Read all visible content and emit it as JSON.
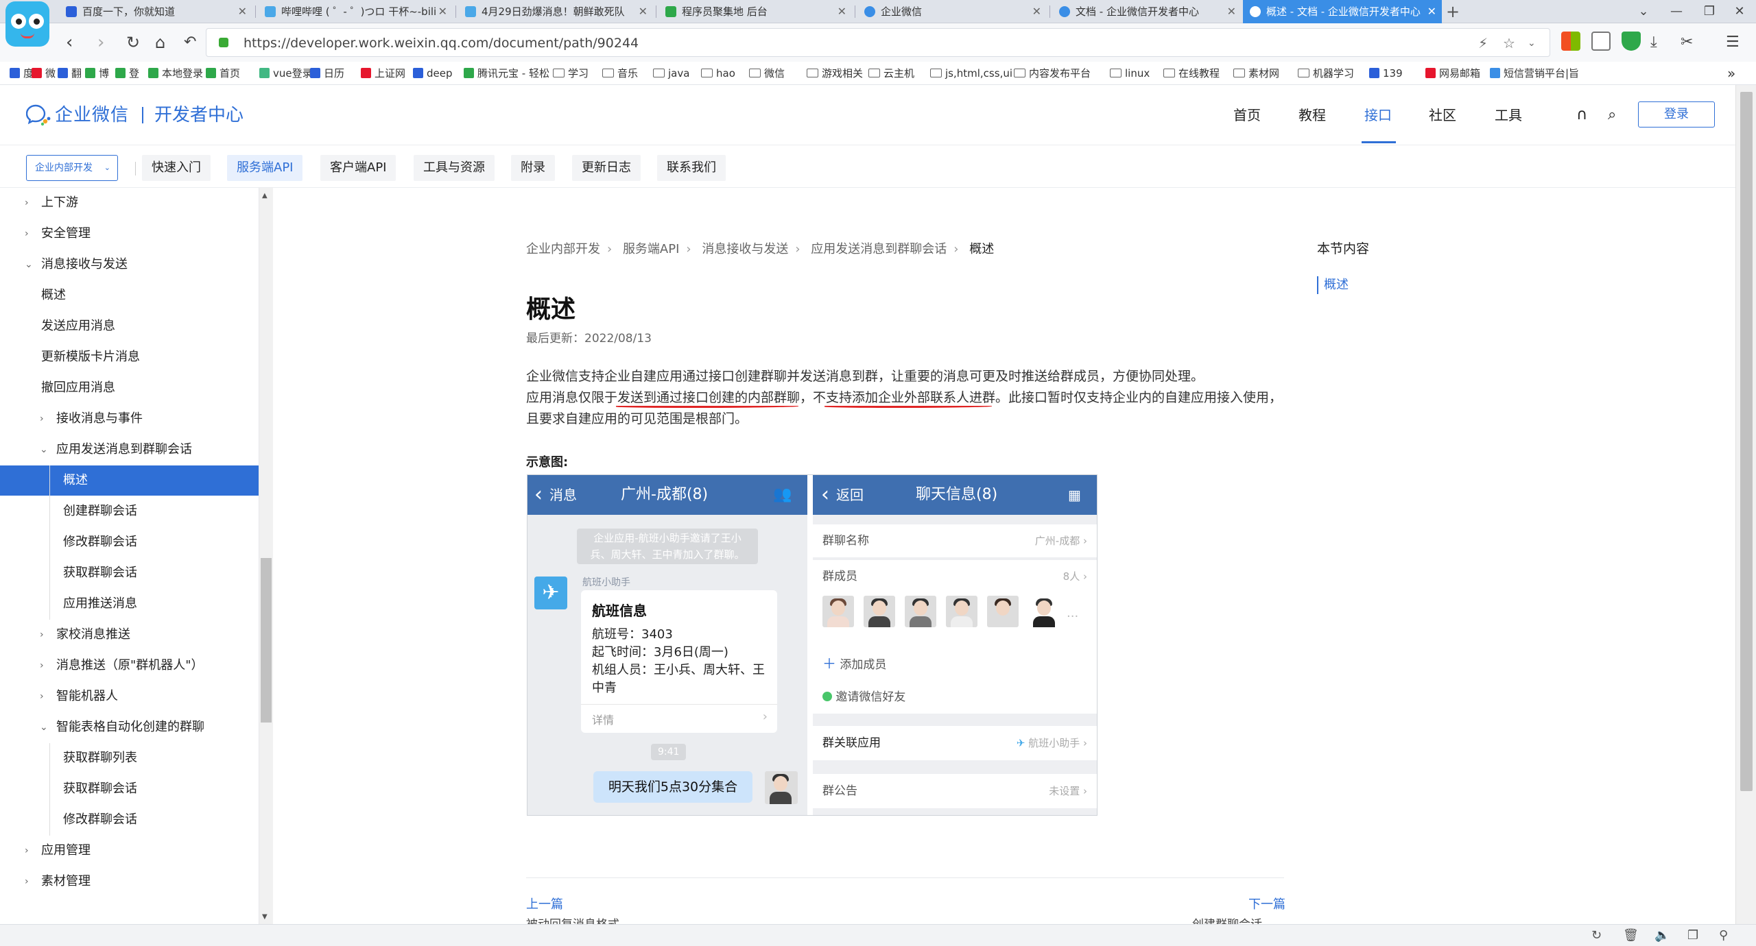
{
  "browser": {
    "tabs": [
      {
        "title": "百度一下，你就知道",
        "color": "#2b5fd9"
      },
      {
        "title": "哔哩哔哩 ( ゜- ゜)つロ 干杯~-bili",
        "color": "#4aa8e8"
      },
      {
        "title": "4月29日劲爆消息！朝鲜敢死队",
        "color": "#4aa8e8"
      },
      {
        "title": "程序员聚集地 后台",
        "color": "#2ea84a"
      },
      {
        "title": "企业微信",
        "color": "#3a8ee6"
      },
      {
        "title": "文档 - 企业微信开发者中心",
        "color": "#3a8ee6"
      },
      {
        "title": "概述 - 文档 - 企业微信开发者中心",
        "color": "#ffffff"
      }
    ],
    "new_tab_icon": "+",
    "window_controls": [
      "⌄",
      "—",
      "❐",
      "✕"
    ],
    "url": "https://developer.work.weixin.qq.com/document/path/90244",
    "bookmarks": [
      {
        "label": "度",
        "type": "site",
        "color": "#2b5fd9"
      },
      {
        "label": "微",
        "type": "site",
        "color": "#e6162d"
      },
      {
        "label": "翻",
        "type": "site",
        "color": "#2b5fd9"
      },
      {
        "label": "博",
        "type": "site",
        "color": "#2ea84a"
      },
      {
        "label": "登",
        "type": "site",
        "color": "#2ea84a"
      },
      {
        "label": "本地登录",
        "type": "site",
        "color": "#2ea84a"
      },
      {
        "label": "首页",
        "type": "site",
        "color": "#2ea84a"
      },
      {
        "label": "vue登录",
        "type": "site",
        "color": "#41b883"
      },
      {
        "label": "日历",
        "type": "site",
        "color": "#2b5fd9"
      },
      {
        "label": "上证网",
        "type": "site",
        "color": "#e6162d"
      },
      {
        "label": "deep",
        "type": "site",
        "color": "#2b5fd9"
      },
      {
        "label": "腾讯元宝 - 轻松",
        "type": "site",
        "color": "#2ea84a"
      },
      {
        "label": "学习",
        "type": "folder"
      },
      {
        "label": "音乐",
        "type": "folder"
      },
      {
        "label": "java",
        "type": "folder"
      },
      {
        "label": "hao",
        "type": "folder"
      },
      {
        "label": "微信",
        "type": "folder"
      },
      {
        "label": "游戏相关",
        "type": "folder"
      },
      {
        "label": "云主机",
        "type": "folder"
      },
      {
        "label": "js,html,css,ui",
        "type": "folder"
      },
      {
        "label": "内容发布平台",
        "type": "folder"
      },
      {
        "label": "linux",
        "type": "folder"
      },
      {
        "label": "在线教程",
        "type": "folder"
      },
      {
        "label": "素材网",
        "type": "folder"
      },
      {
        "label": "机器学习",
        "type": "folder"
      },
      {
        "label": "139",
        "type": "site",
        "color": "#2b5fd9"
      },
      {
        "label": "网易邮箱",
        "type": "site",
        "color": "#e6162d"
      },
      {
        "label": "短信营销平台|旨",
        "type": "site",
        "color": "#3a8ee6"
      }
    ]
  },
  "site": {
    "brand": "企业微信",
    "brand_sub": "开发者中心",
    "nav": [
      "首页",
      "教程",
      "接口",
      "社区",
      "工具"
    ],
    "nav_active_index": 2,
    "login": "登录",
    "dev_select": "企业内部开发",
    "subnav": [
      "快速入门",
      "服务端API",
      "客户端API",
      "工具与资源",
      "附录",
      "更新日志",
      "联系我们"
    ],
    "subnav_active_index": 1
  },
  "sidebar": {
    "items": [
      {
        "label": "上下游",
        "level": 0,
        "arrow": "›"
      },
      {
        "label": "安全管理",
        "level": 0,
        "arrow": "›"
      },
      {
        "label": "消息接收与发送",
        "level": 0,
        "arrow": "⌄"
      },
      {
        "label": "概述",
        "level": 1,
        "arrow": ""
      },
      {
        "label": "发送应用消息",
        "level": 1,
        "arrow": ""
      },
      {
        "label": "更新模版卡片消息",
        "level": 1,
        "arrow": ""
      },
      {
        "label": "撤回应用消息",
        "level": 1,
        "arrow": ""
      },
      {
        "label": "接收消息与事件",
        "level": 1,
        "arrow": "›"
      },
      {
        "label": "应用发送消息到群聊会话",
        "level": 1,
        "arrow": "⌄"
      },
      {
        "label": "概述",
        "level": 2,
        "arrow": "",
        "active": true
      },
      {
        "label": "创建群聊会话",
        "level": 2,
        "arrow": ""
      },
      {
        "label": "修改群聊会话",
        "level": 2,
        "arrow": ""
      },
      {
        "label": "获取群聊会话",
        "level": 2,
        "arrow": ""
      },
      {
        "label": "应用推送消息",
        "level": 2,
        "arrow": ""
      },
      {
        "label": "家校消息推送",
        "level": 1,
        "arrow": "›"
      },
      {
        "label": "消息推送（原\"群机器人\"）",
        "level": 1,
        "arrow": "›"
      },
      {
        "label": "智能机器人",
        "level": 1,
        "arrow": "›"
      },
      {
        "label": "智能表格自动化创建的群聊",
        "level": 1,
        "arrow": "⌄"
      },
      {
        "label": "获取群聊列表",
        "level": 2,
        "arrow": ""
      },
      {
        "label": "获取群聊会话",
        "level": 2,
        "arrow": ""
      },
      {
        "label": "修改群聊会话",
        "level": 2,
        "arrow": ""
      },
      {
        "label": "应用管理",
        "level": 0,
        "arrow": "›"
      },
      {
        "label": "素材管理",
        "level": 0,
        "arrow": "›"
      }
    ]
  },
  "content": {
    "breadcrumb": [
      "企业内部开发",
      "服务端API",
      "消息接收与发送",
      "应用发送消息到群聊会话",
      "概述"
    ],
    "title": "概述",
    "updated": "最后更新：2022/08/13",
    "line1": "企业微信支持企业自建应用通过接口创建群聊并发送消息到群，让重要的消息可更及时推送给群成员，方便协同处理。",
    "line2": "应用消息仅限于发送到通过接口创建的内部群聊，不支持添加企业外部联系人进群。此接口暂时仅支持企业内的自建应用接入使用，",
    "line3": "且要求自建应用的可见范围是根部门。",
    "figure_label": "示意图:",
    "prev_label": "上一篇",
    "next_label": "下一篇",
    "prev_title": "被动回复消息格式",
    "next_title": "创建群聊会话"
  },
  "figure": {
    "left": {
      "back": "消息",
      "title": "广州-成都(8)",
      "system_msg": [
        "企业应用-航班小助手邀请了王小",
        "兵、周大轩、王中青加入了群聊。"
      ],
      "sender": "航班小助手",
      "card_title": "航班信息",
      "card_lines": [
        "航班号：3403",
        "起飞时间：3月6日(周一)",
        "机组人员：王小兵、周大轩、王",
        "中青"
      ],
      "card_detail": "详情",
      "time": "9:41",
      "my_msg": "明天我们5点30分集合"
    },
    "right": {
      "back": "返回",
      "title": "聊天信息(8)",
      "rows": [
        {
          "label": "群聊名称",
          "value": "广州-成都"
        },
        {
          "label": "群成员",
          "value": "8人"
        }
      ],
      "add_member": "添加成员",
      "invite": "邀请微信好友",
      "app_label": "群关联应用",
      "app_value": "航班小助手",
      "notice_label": "群公告",
      "notice_value": "未设置"
    }
  },
  "toc": {
    "heading": "本节内容",
    "items": [
      "概述"
    ]
  }
}
